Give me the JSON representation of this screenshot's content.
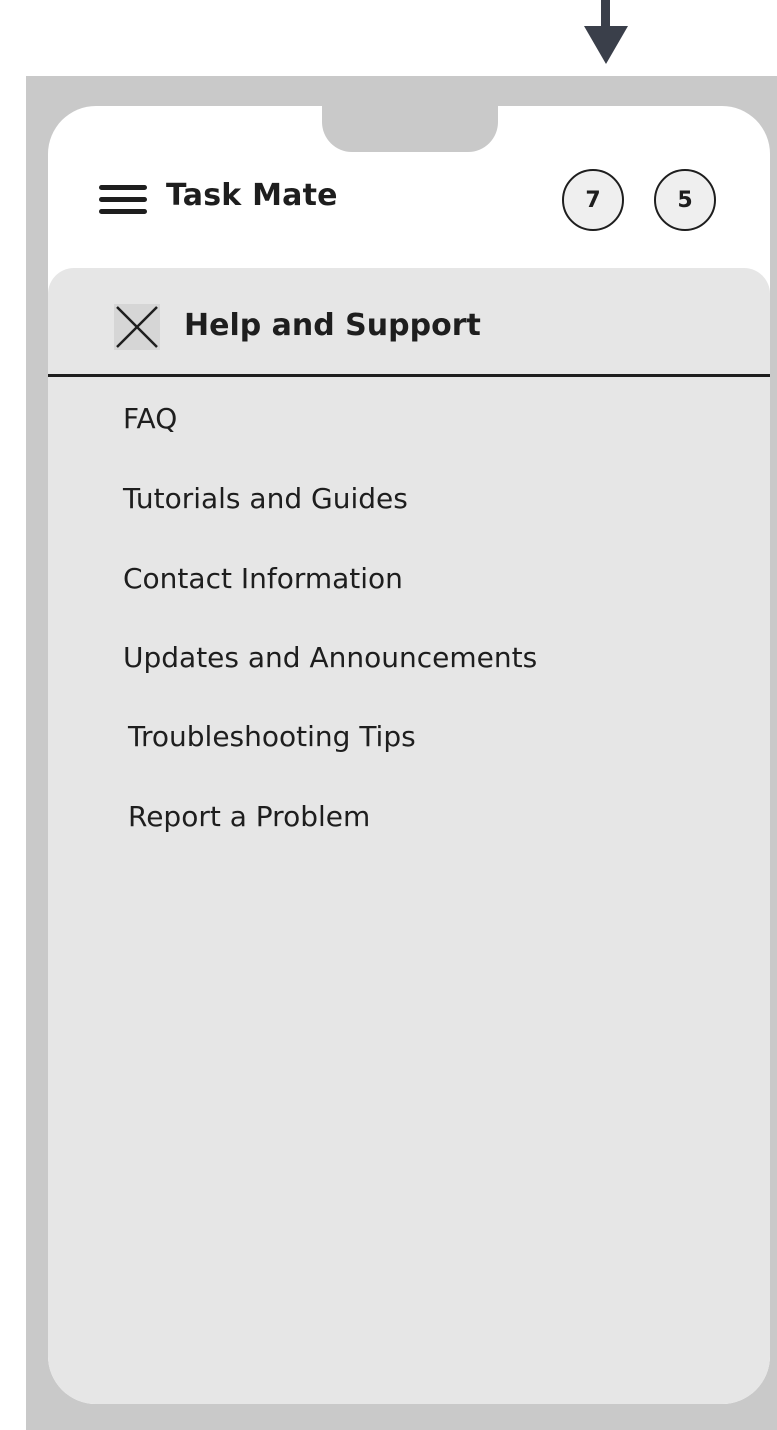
{
  "header": {
    "app_title": "Task Mate",
    "badges": [
      "7",
      "5"
    ]
  },
  "panel": {
    "title": "Help and Support",
    "items": [
      {
        "label": "FAQ"
      },
      {
        "label": "Tutorials and Guides"
      },
      {
        "label": "Contact Information"
      },
      {
        "label": "Updates and Announcements"
      },
      {
        "label": "Troubleshooting Tips"
      },
      {
        "label": "Report a Problem"
      }
    ]
  },
  "icons": {
    "top": "arrow-down-icon",
    "menu": "hamburger-menu-icon",
    "close": "close-icon"
  },
  "colors": {
    "frame": "#c9c9c9",
    "screen": "#ffffff",
    "panel": "#e6e6e6",
    "ink": "#1e1e1e"
  }
}
